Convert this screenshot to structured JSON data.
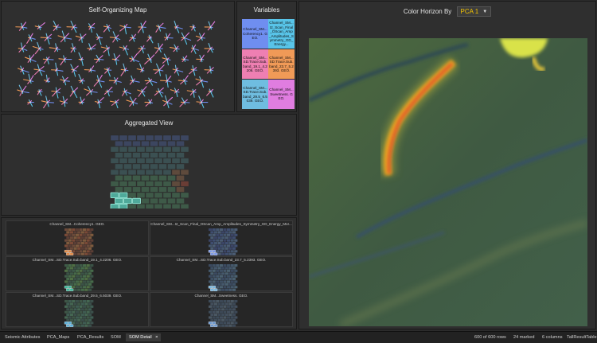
{
  "som": {
    "title": "Self-Organizing Map"
  },
  "variables": {
    "title": "Variables",
    "items": [
      {
        "label": "Channel_SM...Coherency1. GEO.",
        "color": "#6f8ef0"
      },
      {
        "label": "Channel_SM...I2_Scan_Final_OScan_Amp_Amplitudes_Symmetry_GD_Energy...",
        "color": "#58c4e8"
      },
      {
        "label": "Channel_SM...SD.Trace.Sub.band_19.1_4.2206. GEO.",
        "color": "#ee7fb2"
      },
      {
        "label": "Channel_SM...SD.Trace.Sub.band_23.7_5.2393. GEO.",
        "color": "#f09a57"
      },
      {
        "label": "Channel_SM...SD.Trace.Sub.band_29.5_6.5039. GEO.",
        "color": "#6fbde0"
      },
      {
        "label": "Channel_SM...Sweetness. GEO.",
        "color": "#e07de0"
      }
    ]
  },
  "aggregated": {
    "title": "Aggregated View"
  },
  "multiples": [
    {
      "label": "Channel_SM...Coherency1. GEO."
    },
    {
      "label": "Channel_SM...I2_Scan_Final_OScan_Amp_Amplitudes_Symmetry_GD_Energy_Mor..."
    },
    {
      "label": "Channel_SM...SD.Trace.Sub.band_19.1_4.2206. GEO."
    },
    {
      "label": "Channel_SM...SD.Trace.Sub.band_23.7_5.2393. GEO."
    },
    {
      "label": "Channel_SM...SD.Trace.Sub.band_29.5_6.5039. GEO."
    },
    {
      "label": "Channel_SM...Sweetness. GEO."
    }
  ],
  "map": {
    "title": "Color Horizon By",
    "selected": "PCA 1"
  },
  "tabs": [
    "Seismic Attributes",
    "PCA_Maps",
    "PCA_Results",
    "SOM",
    "SOM Detail"
  ],
  "status": {
    "rows": "600 of 600 rows",
    "marked": "24 marked",
    "columns": "6 columns",
    "table": "TallResultTable"
  }
}
